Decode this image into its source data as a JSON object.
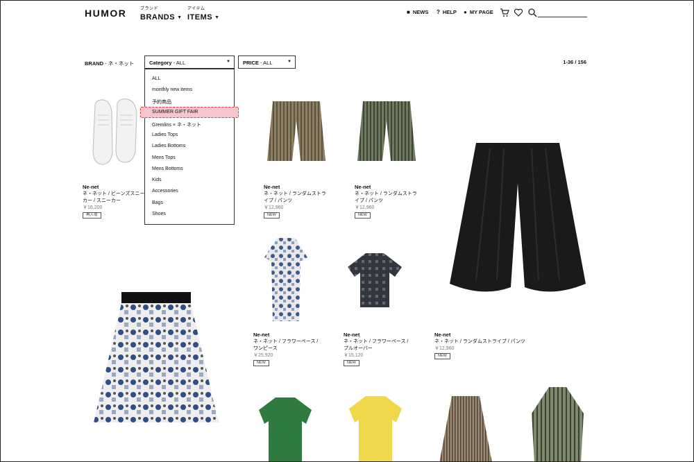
{
  "header": {
    "logo": "HUMOR",
    "brands_small": "ブランド",
    "brands": "BRANDS",
    "items_small": "アイテム",
    "items": "ITEMS",
    "news": "NEWS",
    "help": "HELP",
    "mypage": "MY PAGE"
  },
  "filters": {
    "brand_label": "BRAND",
    "brand_value": "- ネ・ネット",
    "category_label": "Category",
    "category_value": "- ALL",
    "price_label": "PRICE",
    "price_value": "- ALL",
    "result_count": "1-36 / 156"
  },
  "category_options": [
    "ALL",
    "monthly new items",
    "予約商品",
    "SUMMER GIFT FAIR",
    "Gremlins × ネ・ネット",
    "Ladies Tops",
    "Ladies Bottoms",
    "Mens Tops",
    "Mens Bottoms",
    "Kids",
    "Accessories",
    "Bags",
    "Shoes"
  ],
  "products": [
    {
      "brand": "Ne-net",
      "name1": "ネ・ネット / ビーンズスニー",
      "name2": "カー / スニーカー",
      "price": "￥16,200",
      "badge": "再入荷"
    },
    {
      "brand": "Ne-net",
      "name1": "ネ・ネット / ランダムストラ",
      "name2": "イプ / パンツ",
      "price": "￥12,960",
      "badge": "NEW"
    },
    {
      "brand": "Ne-net",
      "name1": "ネ・ネット / ランダムストラ",
      "name2": "イプ / パンツ",
      "price": "￥12,960",
      "badge": "NEW"
    },
    {
      "brand": "Ne-net",
      "name1": "ネ・ネット / フラワーペース /",
      "name2": "ワンピース",
      "price": "￥25,920",
      "badge": "NEW"
    },
    {
      "brand": "Ne-net",
      "name1": "ネ・ネット / フラワーペース /",
      "name2": "プルオーバー",
      "price": "￥15,120",
      "badge": "NEW"
    },
    {
      "brand": "Ne-net",
      "name1": "ネ・ネット / ランダムストライプ / パンツ",
      "name2": "",
      "price": "￥12,960",
      "badge": "NEW"
    }
  ]
}
